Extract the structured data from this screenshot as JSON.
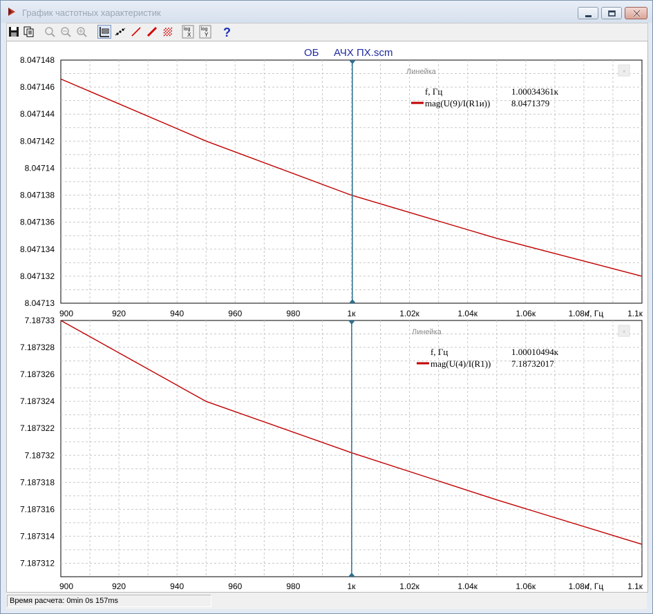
{
  "window": {
    "title": "График частотных характеристик"
  },
  "toolbar": {
    "buttons": [
      {
        "name": "save-button",
        "icon": "save-icon"
      },
      {
        "name": "copy-button",
        "icon": "copy-icon"
      },
      {
        "name": "zoom-button",
        "icon": "zoom-icon"
      },
      {
        "name": "zoom-out-button",
        "icon": "zoom-out-icon"
      },
      {
        "name": "zoom-in-button",
        "icon": "zoom-in-icon"
      },
      {
        "name": "ruler-button",
        "icon": "ruler-icon"
      },
      {
        "name": "points-button",
        "icon": "points-icon"
      },
      {
        "name": "line-button",
        "icon": "line-icon"
      },
      {
        "name": "bold-line-button",
        "icon": "bold-line-icon"
      },
      {
        "name": "hatch-button",
        "icon": "hatch-icon"
      },
      {
        "name": "log-x-button",
        "icon": "log-x-icon",
        "top": "log",
        "bottom": "X"
      },
      {
        "name": "log-y-button",
        "icon": "log-y-icon",
        "top": "log",
        "bottom": "Y"
      },
      {
        "name": "help-button",
        "icon": "help-icon",
        "label": "?"
      }
    ]
  },
  "plot": {
    "title_left": "ОБ",
    "title_right": "АЧХ ПХ.scm",
    "cursor_color": "#2e6f8e",
    "curve_color": "#c00000"
  },
  "status": {
    "text": "Время расчета: 0min 0s 157ms"
  },
  "chart_data": [
    {
      "type": "line",
      "title": "",
      "xlabel": "f, Гц",
      "x_ticks": [
        "900",
        "920",
        "940",
        "960",
        "980",
        "1к",
        "1.02к",
        "1.04к",
        "1.06к",
        "1.08к",
        "1.1к"
      ],
      "y_ticks": [
        "8.04713",
        "8.047132",
        "8.047134",
        "8.047136",
        "8.047138",
        "8.04714",
        "8.047142",
        "8.047144",
        "8.047146",
        "8.047148"
      ],
      "xlim": [
        900,
        1100
      ],
      "ylim": [
        8.04713,
        8.047148
      ],
      "series": [
        {
          "name": "mag(U(9)/I(R1и))",
          "x": [
            900,
            950,
            1000,
            1050,
            1100
          ],
          "y": [
            8.0471466,
            8.047142,
            8.047138,
            8.0471348,
            8.047132
          ]
        }
      ],
      "ruler": {
        "title": "Линейка",
        "freq_label": "f, Гц",
        "freq_value": "1.00034361к",
        "series_label": "mag(U(9)/I(R1и))",
        "series_value": "8.0471379",
        "cursor_x": 1000.34361
      }
    },
    {
      "type": "line",
      "title": "",
      "xlabel": "f, Гц",
      "x_ticks": [
        "900",
        "920",
        "940",
        "960",
        "980",
        "1к",
        "1.02к",
        "1.04к",
        "1.06к",
        "1.08к",
        "1.1к"
      ],
      "y_ticks": [
        "7.187312",
        "7.187314",
        "7.187316",
        "7.187318",
        "7.18732",
        "7.187322",
        "7.187324",
        "7.187326",
        "7.187328",
        "7.18733"
      ],
      "xlim": [
        900,
        1100
      ],
      "ylim": [
        7.187311,
        7.18733
      ],
      "series": [
        {
          "name": "mag(U(4)/I(R1))",
          "x": [
            900,
            950,
            1000,
            1050,
            1100
          ],
          "y": [
            7.18733,
            7.187324,
            7.1873202,
            7.1873167,
            7.1873134
          ]
        }
      ],
      "ruler": {
        "title": "Линейка",
        "freq_label": "f, Гц",
        "freq_value": "1.00010494к",
        "series_label": "mag(U(4)/I(R1))",
        "series_value": "7.18732017",
        "cursor_x": 1000.10494
      }
    }
  ]
}
